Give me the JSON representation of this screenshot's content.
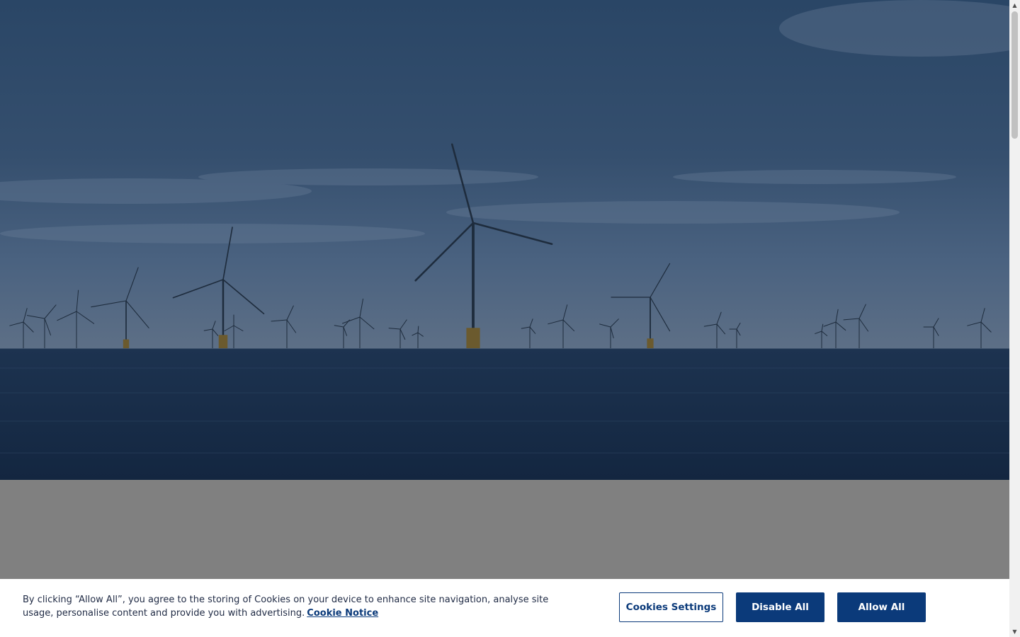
{
  "hero": {
    "image": "offshore-wind-farm-photo"
  },
  "cookie_banner": {
    "text": "By clicking “Allow All”, you agree to the storing of Cookies on your device to enhance site navigation, analyse site usage, personalise content and provide you with advertising.",
    "link_label": "Cookie Notice",
    "settings_label": "Cookies Settings",
    "disable_label": "Disable All",
    "allow_label": "Allow All"
  },
  "colors": {
    "primary": "#0b3a7a",
    "overlay": "#808080"
  },
  "scrollbar": {
    "up_icon": "chevron-up-icon",
    "down_icon": "chevron-down-icon"
  }
}
